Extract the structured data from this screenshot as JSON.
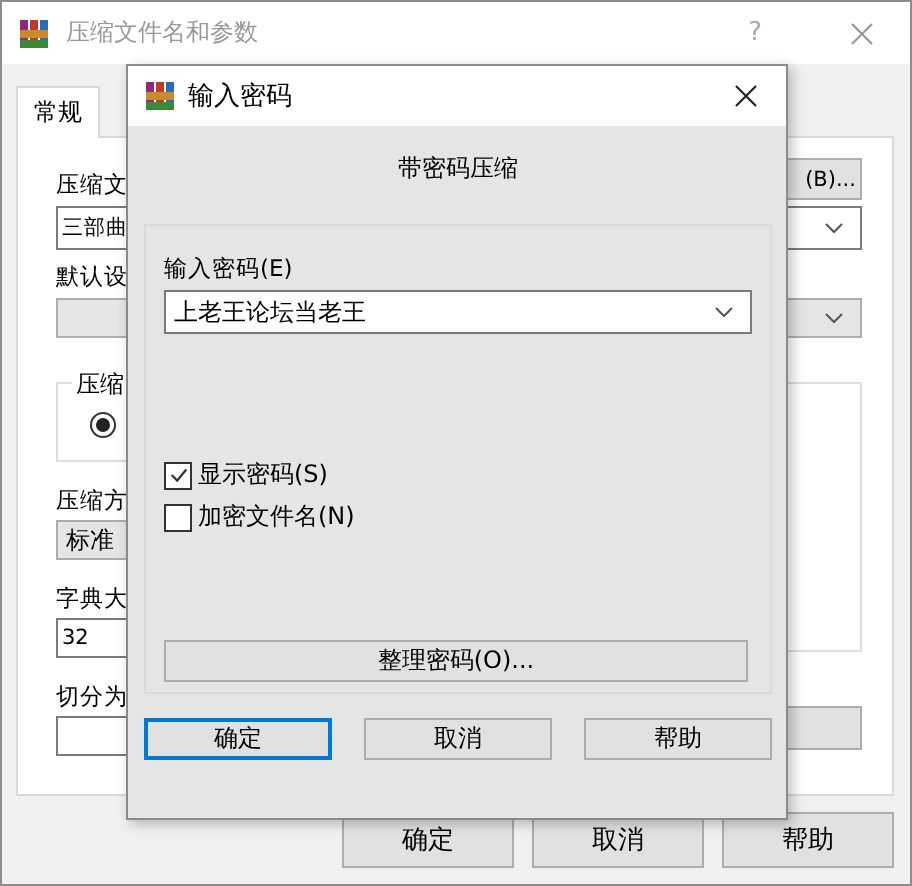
{
  "window": {
    "title": "压缩文件名和参数",
    "help_button": "?"
  },
  "tabs": [
    {
      "label": "常规",
      "selected": true
    }
  ],
  "general": {
    "archive_name": {
      "label": "压缩文",
      "value": "三部曲",
      "browse_button": "(B)..."
    },
    "profile": {
      "label": "默认设"
    },
    "format_group": {
      "label": "压缩",
      "radio_selected": true
    },
    "method": {
      "label": "压缩方",
      "value": "标准"
    },
    "dictionary": {
      "label": "字典大",
      "value": "32"
    },
    "split": {
      "label": "切分为"
    }
  },
  "buttons": [
    "确定",
    "取消",
    "帮助"
  ],
  "password_dialog": {
    "title": "输入密码",
    "heading": "带密码压缩",
    "password_label": "输入密码(E)",
    "password_value": "上老王论坛当老王",
    "options": [
      {
        "label": "显示密码(S)",
        "checked": true
      },
      {
        "label": "加密文件名(N)",
        "checked": false
      }
    ],
    "organize_button": "整理密码(O)...",
    "buttons": [
      {
        "label": "确定",
        "default": true
      },
      {
        "label": "取消",
        "default": false
      },
      {
        "label": "帮助",
        "default": false
      }
    ]
  }
}
